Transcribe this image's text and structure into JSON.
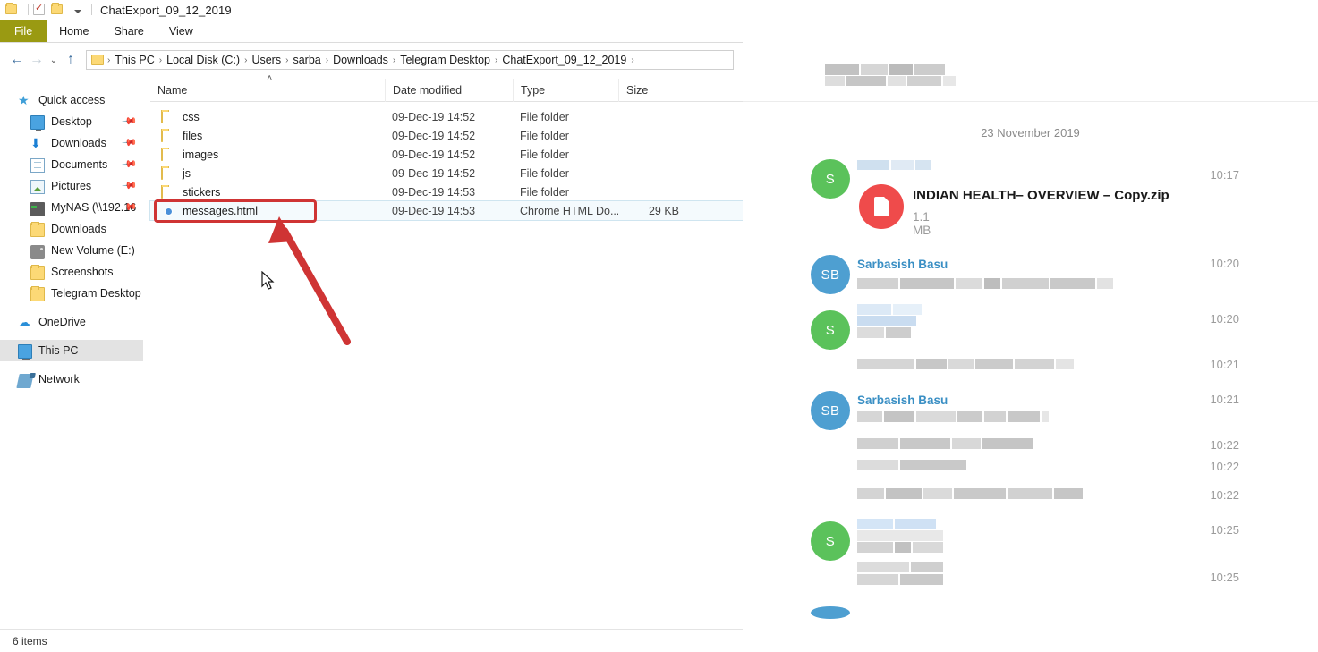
{
  "window": {
    "title": "ChatExport_09_12_2019",
    "quick_access_toolbar": [
      "folder-icon",
      "properties-icon",
      "new-folder-icon",
      "customize-caret-icon"
    ],
    "tabs": [
      {
        "label": "File",
        "active": true
      },
      {
        "label": "Home",
        "active": false
      },
      {
        "label": "Share",
        "active": false
      },
      {
        "label": "View",
        "active": false
      }
    ]
  },
  "address_bar": {
    "back_label": "←",
    "forward_label": "→",
    "recent_label": "⌄",
    "up_label": "↑",
    "crumbs": [
      "This PC",
      "Local Disk (C:)",
      "Users",
      "sarba",
      "Downloads",
      "Telegram Desktop",
      "ChatExport_09_12_2019"
    ],
    "separator": "›"
  },
  "columns": [
    {
      "label": "Name",
      "key": "name"
    },
    {
      "label": "Date modified",
      "key": "date"
    },
    {
      "label": "Type",
      "key": "type"
    },
    {
      "label": "Size",
      "key": "size"
    }
  ],
  "sort_indicator": "˄",
  "nav_pane": {
    "items": [
      {
        "label": "Quick access",
        "icon": "star-icon",
        "icon_class": "ic-star",
        "glyph": "★",
        "indent": false,
        "pinned": false,
        "selected": false
      },
      {
        "label": "Desktop",
        "icon": "desktop-icon",
        "icon_class": "ic-desktop",
        "glyph": "",
        "indent": true,
        "pinned": true,
        "selected": false
      },
      {
        "label": "Downloads",
        "icon": "download-icon",
        "icon_class": "ic-down",
        "glyph": "⬇",
        "indent": true,
        "pinned": true,
        "selected": false
      },
      {
        "label": "Documents",
        "icon": "documents-icon",
        "icon_class": "ic-doc",
        "glyph": "",
        "indent": true,
        "pinned": true,
        "selected": false
      },
      {
        "label": "Pictures",
        "icon": "pictures-icon",
        "icon_class": "ic-pic",
        "glyph": "",
        "indent": true,
        "pinned": true,
        "selected": false
      },
      {
        "label": "MyNAS (\\\\192.16",
        "icon": "nas-icon",
        "icon_class": "ic-nas",
        "glyph": "",
        "indent": true,
        "pinned": true,
        "selected": false
      },
      {
        "label": "Downloads",
        "icon": "folder-icon",
        "icon_class": "ic-folder",
        "glyph": "",
        "indent": true,
        "pinned": false,
        "selected": false
      },
      {
        "label": "New Volume (E:)",
        "icon": "drive-icon",
        "icon_class": "ic-drive",
        "glyph": "",
        "indent": true,
        "pinned": false,
        "selected": false
      },
      {
        "label": "Screenshots",
        "icon": "folder-icon",
        "icon_class": "ic-folder",
        "glyph": "",
        "indent": true,
        "pinned": false,
        "selected": false
      },
      {
        "label": "Telegram Desktop",
        "icon": "folder-icon",
        "icon_class": "ic-folder",
        "glyph": "",
        "indent": true,
        "pinned": false,
        "selected": false
      },
      {
        "label": "OneDrive",
        "icon": "cloud-icon",
        "icon_class": "ic-cloud",
        "glyph": "☁",
        "indent": false,
        "pinned": false,
        "selected": false,
        "gap_before": true
      },
      {
        "label": "This PC",
        "icon": "this-pc-icon",
        "icon_class": "ic-pc",
        "glyph": "",
        "indent": false,
        "pinned": false,
        "selected": true,
        "gap_before": true
      },
      {
        "label": "Network",
        "icon": "network-icon",
        "icon_class": "ic-net",
        "glyph": "",
        "indent": false,
        "pinned": false,
        "selected": false,
        "gap_before": true
      }
    ]
  },
  "files": [
    {
      "name": "css",
      "date": "09-Dec-19 14:52",
      "type": "File folder",
      "size": "",
      "icon": "folder-icon",
      "selected": false
    },
    {
      "name": "files",
      "date": "09-Dec-19 14:52",
      "type": "File folder",
      "size": "",
      "icon": "folder-icon",
      "selected": false
    },
    {
      "name": "images",
      "date": "09-Dec-19 14:52",
      "type": "File folder",
      "size": "",
      "icon": "folder-icon",
      "selected": false
    },
    {
      "name": "js",
      "date": "09-Dec-19 14:52",
      "type": "File folder",
      "size": "",
      "icon": "folder-icon",
      "selected": false
    },
    {
      "name": "stickers",
      "date": "09-Dec-19 14:53",
      "type": "File folder",
      "size": "",
      "icon": "folder-icon",
      "selected": false
    },
    {
      "name": "messages.html",
      "date": "09-Dec-19 14:53",
      "type": "Chrome HTML Do...",
      "size": "29 KB",
      "icon": "chrome-icon",
      "selected": true
    }
  ],
  "status_bar": {
    "item_count": "6 items"
  },
  "annotation": {
    "highlight_target": "messages.html",
    "color": "#cf3434",
    "arrow": "arrow-pointing-to-messages-html",
    "cursor": "mouse-pointer"
  },
  "chat": {
    "date_separator": "23 November 2019",
    "messages": [
      {
        "id": 1,
        "avatar": "S",
        "avatar_color": "#5bc25b",
        "sender": "",
        "time": "10:17",
        "attachment": {
          "filename": "INDIAN HEALTH– OVERVIEW – Copy.zip",
          "size": "1.1 MB",
          "icon": "document-icon",
          "icon_color": "#ef4b4b"
        }
      },
      {
        "id": 2,
        "avatar": "SB",
        "avatar_color": "#4e9fd1",
        "sender": "Sarbasish Basu",
        "time": "10:20",
        "attachment": null
      },
      {
        "id": 3,
        "avatar": "S",
        "avatar_color": "#5bc25b",
        "sender": "",
        "time": "10:20",
        "attachment": null
      },
      {
        "id": 4,
        "avatar": "",
        "avatar_color": "",
        "sender": "",
        "time": "10:21",
        "attachment": null
      },
      {
        "id": 5,
        "avatar": "SB",
        "avatar_color": "#4e9fd1",
        "sender": "Sarbasish Basu",
        "time": "10:21",
        "attachment": null
      },
      {
        "id": 6,
        "avatar": "",
        "avatar_color": "",
        "sender": "",
        "time": "10:22",
        "attachment": null
      },
      {
        "id": 7,
        "avatar": "",
        "avatar_color": "",
        "sender": "",
        "time": "10:22",
        "attachment": null
      },
      {
        "id": 8,
        "avatar": "",
        "avatar_color": "",
        "sender": "",
        "time": "10:22",
        "attachment": null
      },
      {
        "id": 9,
        "avatar": "S",
        "avatar_color": "#5bc25b",
        "sender": "",
        "time": "10:25",
        "attachment": null
      },
      {
        "id": 10,
        "avatar": "",
        "avatar_color": "",
        "sender": "",
        "time": "10:25",
        "attachment": null
      }
    ]
  },
  "colors": {
    "file_tab": "#9a9a12",
    "selection": "#f4fafd",
    "annotation_red": "#cf3434",
    "telegram_sender_blue": "#3a8fc4",
    "avatar_green": "#5bc25b",
    "avatar_blue": "#4e9fd1",
    "doc_red": "#ef4b4b"
  }
}
